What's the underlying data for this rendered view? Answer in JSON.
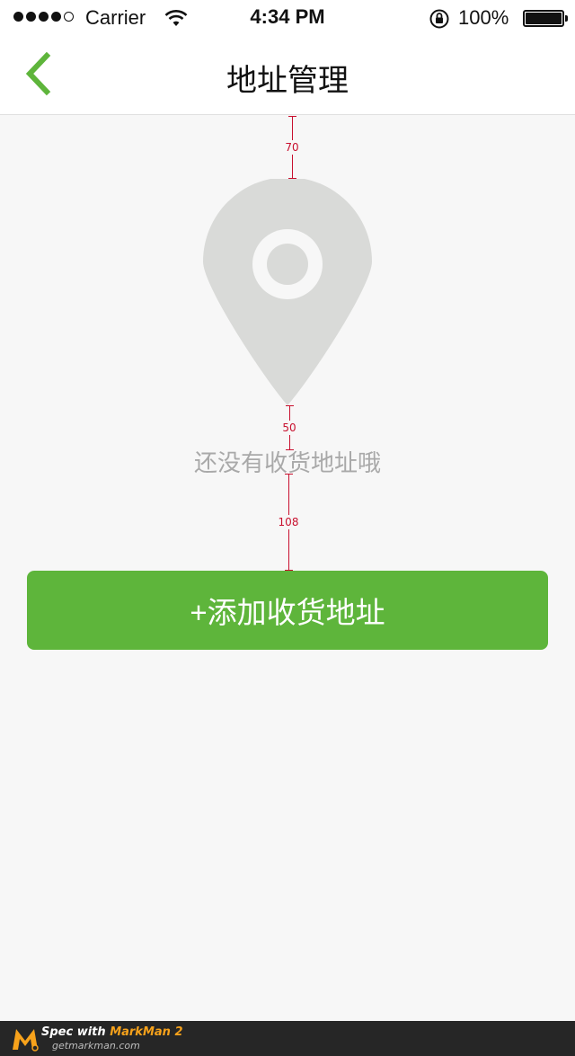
{
  "status_bar": {
    "carrier": "Carrier",
    "time": "4:34 PM",
    "battery_percent": "100%",
    "signal_bars_filled": 4,
    "signal_bars_total": 5,
    "icons": [
      "wifi-icon",
      "rotation-lock-icon",
      "battery-icon"
    ]
  },
  "nav": {
    "title": "地址管理",
    "back_icon": "chevron-left-icon"
  },
  "annotations": {
    "top_gap": "70",
    "pin_to_text_gap": "50",
    "text_to_button_gap": "108",
    "color": "#c8102e"
  },
  "empty_state": {
    "icon": "location-pin-icon",
    "message": "还没有收货地址哦"
  },
  "add_button": {
    "label": "+添加收货地址",
    "color": "#5eb53b"
  },
  "watermark": {
    "prefix": "Spec with ",
    "brand": "MarkMan 2",
    "url": "getmarkman.com"
  },
  "colors": {
    "accent": "#5eb53b",
    "background": "#f7f7f7",
    "pin": "#d9dad8",
    "placeholder_text": "#a9a9a9"
  }
}
